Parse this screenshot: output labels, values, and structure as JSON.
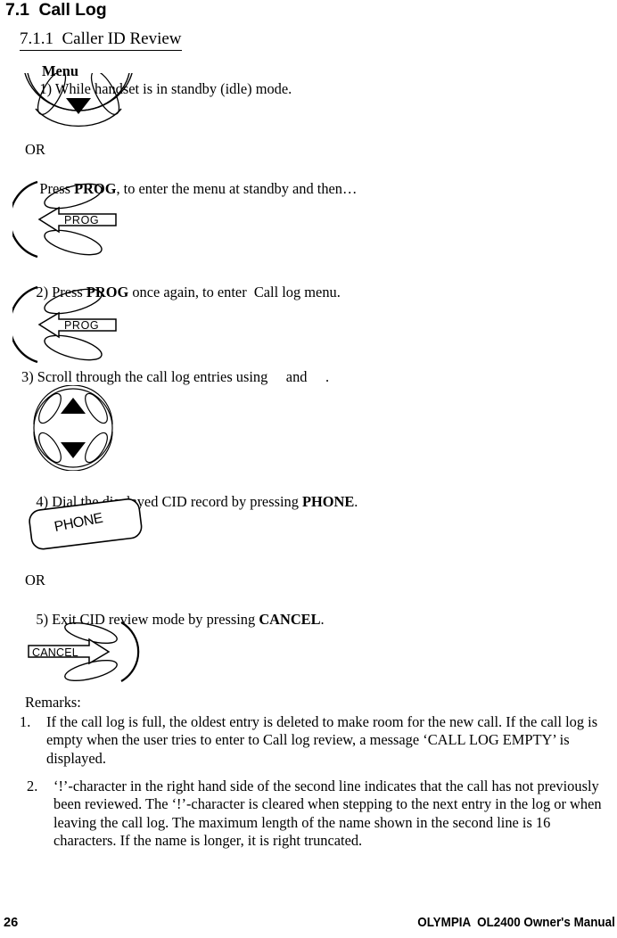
{
  "document": {
    "section_number": "7.1",
    "section_title": "Call Log",
    "section_heading": "7.1  Call Log",
    "subsection_heading": "7.1.1  Caller ID Review"
  },
  "steps": {
    "step1_prefix": "1) ",
    "step1_text": "While handset is in standby (idle) mode.",
    "step1_overlap_text": "Menu",
    "or_1": "OR",
    "step1_alt_a": "Press ",
    "step1_alt_key": "PROG",
    "step1_alt_b": ", to enter the menu at standby and then…",
    "step2_a": "2) Press ",
    "step2_key": "PROG",
    "step2_b": " once again, to enter  Call log menu.",
    "step3_text": "3) Scroll through the call log entries using     and     .",
    "step4_a": "4) Dial the displayed CID record by pressing ",
    "step4_key": "PHONE",
    "step4_b": ".",
    "or_2": "OR",
    "step5_a": "5) Exit CID review mode by pressing ",
    "step5_key": "CANCEL",
    "step5_b": "."
  },
  "figures": {
    "nav_down_label": "navigation-key-down",
    "prog_key_label": "PROG",
    "phone_key_label": "PHONE",
    "cancel_key_label": "CANCEL",
    "nav_pad_label": "navigation-key-up-down"
  },
  "remarks": {
    "label": "Remarks:",
    "items": [
      {
        "number": "1.",
        "text": "If the call log is full, the oldest entry is deleted to make room for the new call. If the call log is empty when the user tries to enter to Call log review, a message ‘CALL LOG EMPTY’ is displayed."
      },
      {
        "number": "2.",
        "text": "‘!’-character in the right hand side of the second line indicates that the call has not previously been reviewed. The ‘!’-character is cleared when stepping to the next entry in the log or when leaving the call log. The maximum length of the name shown in the second line is 16 characters. If the name is longer, it is right truncated."
      }
    ]
  },
  "footer": {
    "page_number": "26",
    "manual_title": "OLYMPIA  OL2400 Owner's Manual"
  },
  "colors": {
    "text": "#000000",
    "background": "#ffffff"
  }
}
